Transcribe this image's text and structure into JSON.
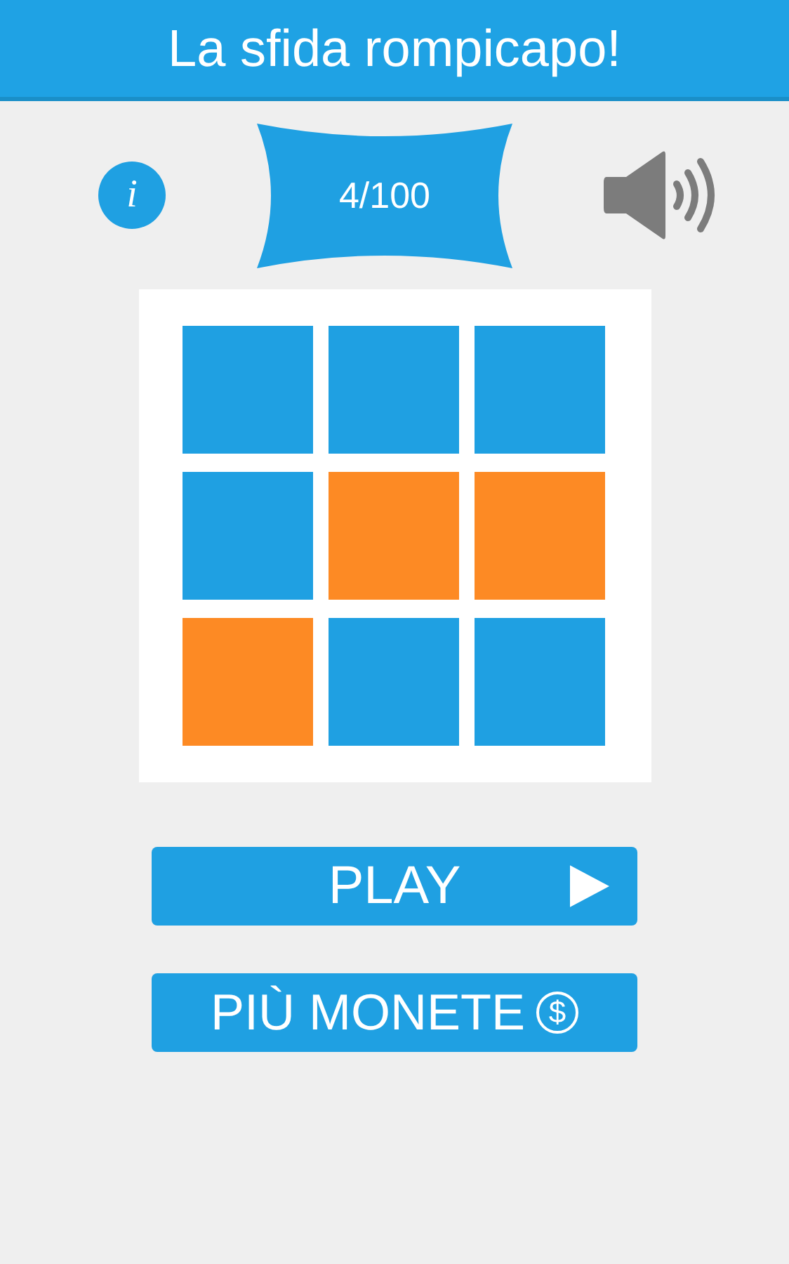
{
  "header": {
    "title": "La sfida rompicapo!"
  },
  "info_button": {
    "label": "i"
  },
  "level_banner": {
    "text": "4/100"
  },
  "board": {
    "tiles": [
      {
        "color": "#1fa0e2"
      },
      {
        "color": "#1fa0e2"
      },
      {
        "color": "#1fa0e2"
      },
      {
        "color": "#1fa0e2"
      },
      {
        "color": "#fd8a24"
      },
      {
        "color": "#fd8a24"
      },
      {
        "color": "#fd8a24"
      },
      {
        "color": "#1fa0e2"
      },
      {
        "color": "#1fa0e2"
      }
    ]
  },
  "buttons": [
    {
      "kind": "play",
      "label": "PLAY"
    },
    {
      "kind": "coins",
      "label": "PIÙ MONETE",
      "icon": "$"
    }
  ]
}
